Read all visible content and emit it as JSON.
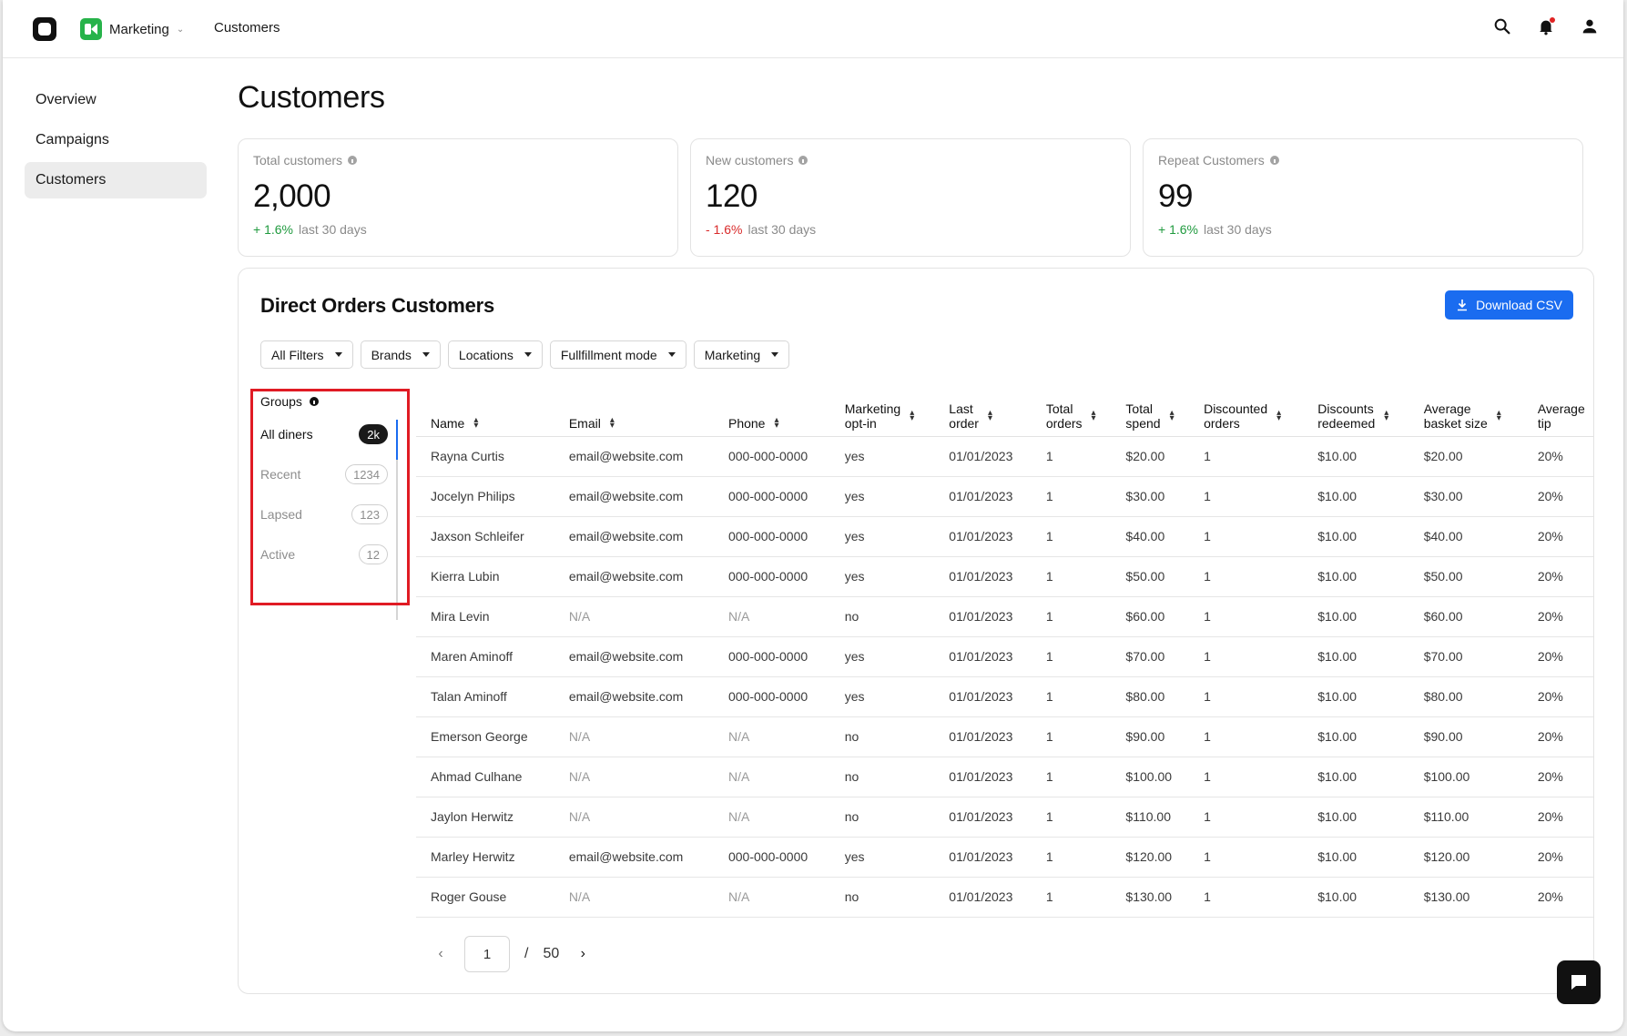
{
  "topbar": {
    "app_name": "Marketing",
    "breadcrumb": "Customers"
  },
  "sidebar": {
    "items": [
      {
        "label": "Overview"
      },
      {
        "label": "Campaigns"
      },
      {
        "label": "Customers"
      }
    ]
  },
  "page": {
    "title": "Customers"
  },
  "stats": [
    {
      "label": "Total customers",
      "value": "2,000",
      "delta": "+ 1.6%",
      "period": "last 30 days"
    },
    {
      "label": "New customers",
      "value": "120",
      "delta": "- 1.6%",
      "period": "last 30 days"
    },
    {
      "label": "Repeat Customers",
      "value": "99",
      "delta": "+ 1.6%",
      "period": "last 30 days"
    }
  ],
  "orders": {
    "title": "Direct Orders Customers",
    "download_label": "Download CSV",
    "filters": [
      "All Filters",
      "Brands",
      "Locations",
      "Fullfillment mode",
      "Marketing"
    ],
    "groups_title": "Groups",
    "groups": [
      {
        "label": "All diners",
        "count": "2k"
      },
      {
        "label": "Recent",
        "count": "1234"
      },
      {
        "label": "Lapsed",
        "count": "123"
      },
      {
        "label": "Active",
        "count": "12"
      }
    ],
    "columns": [
      {
        "l1": "Name",
        "l2": ""
      },
      {
        "l1": "Email",
        "l2": ""
      },
      {
        "l1": "Phone",
        "l2": ""
      },
      {
        "l1": "Marketing",
        "l2": "opt-in"
      },
      {
        "l1": "Last",
        "l2": "order"
      },
      {
        "l1": "Total",
        "l2": "orders"
      },
      {
        "l1": "Total",
        "l2": "spend"
      },
      {
        "l1": "Discounted",
        "l2": "orders"
      },
      {
        "l1": "Discounts",
        "l2": "redeemed"
      },
      {
        "l1": "Average",
        "l2": "basket size"
      },
      {
        "l1": "Average",
        "l2": "tip"
      }
    ],
    "rows": [
      [
        "Rayna Curtis",
        "email@website.com",
        "000-000-0000",
        "yes",
        "01/01/2023",
        "1",
        "$20.00",
        "1",
        "$10.00",
        "$20.00",
        "20%"
      ],
      [
        "Jocelyn Philips",
        "email@website.com",
        "000-000-0000",
        "yes",
        "01/01/2023",
        "1",
        "$30.00",
        "1",
        "$10.00",
        "$30.00",
        "20%"
      ],
      [
        "Jaxson Schleifer",
        "email@website.com",
        "000-000-0000",
        "yes",
        "01/01/2023",
        "1",
        "$40.00",
        "1",
        "$10.00",
        "$40.00",
        "20%"
      ],
      [
        "Kierra Lubin",
        "email@website.com",
        "000-000-0000",
        "yes",
        "01/01/2023",
        "1",
        "$50.00",
        "1",
        "$10.00",
        "$50.00",
        "20%"
      ],
      [
        "Mira Levin",
        "N/A",
        "N/A",
        "no",
        "01/01/2023",
        "1",
        "$60.00",
        "1",
        "$10.00",
        "$60.00",
        "20%"
      ],
      [
        "Maren Aminoff",
        "email@website.com",
        "000-000-0000",
        "yes",
        "01/01/2023",
        "1",
        "$70.00",
        "1",
        "$10.00",
        "$70.00",
        "20%"
      ],
      [
        "Talan Aminoff",
        "email@website.com",
        "000-000-0000",
        "yes",
        "01/01/2023",
        "1",
        "$80.00",
        "1",
        "$10.00",
        "$80.00",
        "20%"
      ],
      [
        "Emerson George",
        "N/A",
        "N/A",
        "no",
        "01/01/2023",
        "1",
        "$90.00",
        "1",
        "$10.00",
        "$90.00",
        "20%"
      ],
      [
        "Ahmad Culhane",
        "N/A",
        "N/A",
        "no",
        "01/01/2023",
        "1",
        "$100.00",
        "1",
        "$10.00",
        "$100.00",
        "20%"
      ],
      [
        "Jaylon Herwitz",
        "N/A",
        "N/A",
        "no",
        "01/01/2023",
        "1",
        "$110.00",
        "1",
        "$10.00",
        "$110.00",
        "20%"
      ],
      [
        "Marley Herwitz",
        "email@website.com",
        "000-000-0000",
        "yes",
        "01/01/2023",
        "1",
        "$120.00",
        "1",
        "$10.00",
        "$120.00",
        "20%"
      ],
      [
        "Roger Gouse",
        "N/A",
        "N/A",
        "no",
        "01/01/2023",
        "1",
        "$130.00",
        "1",
        "$10.00",
        "$130.00",
        "20%"
      ]
    ],
    "pagination": {
      "current": "1",
      "separator": "/",
      "total": "50"
    }
  },
  "colors": {
    "accent": "#1a6cf0",
    "positive": "#1f9a3e",
    "negative": "#d92b2b",
    "highlight": "#e01b24"
  }
}
